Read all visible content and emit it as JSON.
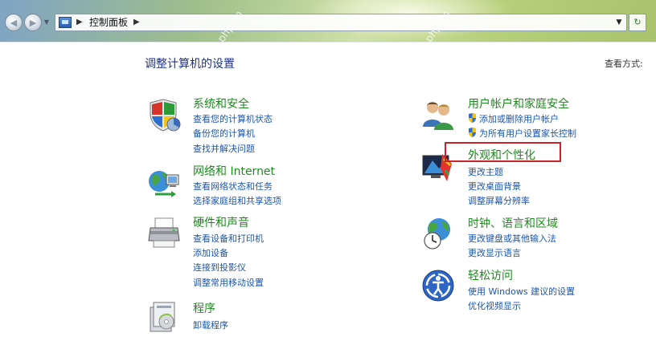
{
  "address_bar": {
    "path": "控制面板",
    "watermark": "php.cn"
  },
  "header": {
    "title": "调整计算机的设置",
    "view_by": "查看方式:"
  },
  "categories": [
    {
      "title": "系统和安全",
      "icon": "shield-security-icon",
      "links": [
        "查看您的计算机状态",
        "备份您的计算机",
        "查找并解决问题"
      ]
    },
    {
      "title": "网络和 Internet",
      "icon": "network-globe-icon",
      "links": [
        "查看网络状态和任务",
        "选择家庭组和共享选项"
      ]
    },
    {
      "title": "硬件和声音",
      "icon": "printer-icon",
      "links": [
        "查看设备和打印机",
        "添加设备",
        "连接到投影仪",
        "调整常用移动设置"
      ]
    },
    {
      "title": "程序",
      "icon": "programs-icon",
      "links": [
        "卸载程序"
      ]
    },
    {
      "title": "用户帐户和家庭安全",
      "icon": "users-icon",
      "links": [
        "添加或删除用户帐户",
        "为所有用户设置家长控制"
      ]
    },
    {
      "title": "外观和个性化",
      "icon": "appearance-icon",
      "links": [
        "更改主题",
        "更改桌面背景",
        "调整屏幕分辨率"
      ]
    },
    {
      "title": "时钟、语言和区域",
      "icon": "clock-globe-icon",
      "links": [
        "更改键盘或其他输入法",
        "更改显示语言"
      ]
    },
    {
      "title": "轻松访问",
      "icon": "ease-of-access-icon",
      "links": [
        "使用 Windows 建议的设置",
        "优化视频显示"
      ]
    }
  ],
  "colors": {
    "category_title": "#1e8a1e",
    "link": "#1b56b0",
    "heading": "#1e3287",
    "highlight_box": "#c8232c"
  }
}
